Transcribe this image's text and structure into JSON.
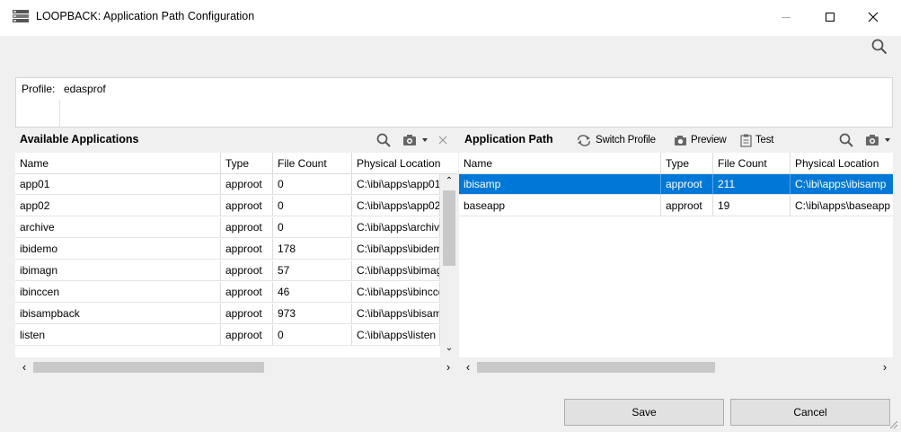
{
  "window": {
    "title": "LOOPBACK: Application Path Configuration",
    "minimize_icon": "minimize-icon",
    "maximize_icon": "maximize-icon",
    "close_icon": "close-icon"
  },
  "profile": {
    "label": "Profile:",
    "value": "edasprof"
  },
  "available": {
    "title": "Available Applications",
    "columns": [
      "Name",
      "Type",
      "File Count",
      "Physical Location"
    ],
    "rows": [
      [
        "app01",
        "approot",
        "0",
        "C:\\ibi\\apps\\app01"
      ],
      [
        "app02",
        "approot",
        "0",
        "C:\\ibi\\apps\\app02"
      ],
      [
        "archive",
        "approot",
        "0",
        "C:\\ibi\\apps\\archive"
      ],
      [
        "ibidemo",
        "approot",
        "178",
        "C:\\ibi\\apps\\ibidemo"
      ],
      [
        "ibimagn",
        "approot",
        "57",
        "C:\\ibi\\apps\\ibimagn"
      ],
      [
        "ibinccen",
        "approot",
        "46",
        "C:\\ibi\\apps\\ibinccen"
      ],
      [
        "ibisampback",
        "approot",
        "973",
        "C:\\ibi\\apps\\ibisampback"
      ],
      [
        "listen",
        "approot",
        "0",
        "C:\\ibi\\apps\\listen"
      ]
    ]
  },
  "path": {
    "title": "Application Path",
    "switch_profile_label": "Switch Profile",
    "preview_label": "Preview",
    "test_label": "Test",
    "columns": [
      "Name",
      "Type",
      "File Count",
      "Physical Location"
    ],
    "rows": [
      [
        "ibisamp",
        "approot",
        "211",
        "C:\\ibi\\apps\\ibisamp"
      ],
      [
        "baseapp",
        "approot",
        "19",
        "C:\\ibi\\apps\\baseapp"
      ]
    ],
    "selected_row": 0
  },
  "buttons": {
    "save": "Save",
    "cancel": "Cancel"
  },
  "colors": {
    "selection": "#0078d7",
    "background": "#f0f0f0"
  }
}
